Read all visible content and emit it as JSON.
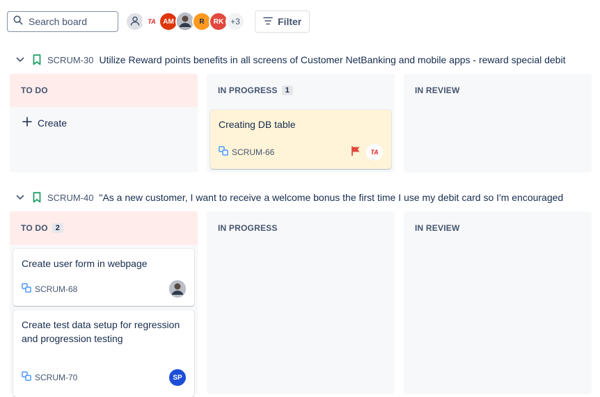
{
  "toolbar": {
    "search_placeholder": "Search board",
    "avatars": [
      {
        "kind": "default",
        "icon": "person-icon"
      },
      {
        "kind": "ta",
        "text": "TA"
      },
      {
        "kind": "am",
        "text": "AM"
      },
      {
        "kind": "photo",
        "icon": "user-photo-icon"
      },
      {
        "kind": "r",
        "text": "R"
      },
      {
        "kind": "rk",
        "text": "RK"
      }
    ],
    "more_count": "+3",
    "filter_label": "Filter"
  },
  "lanes": [
    {
      "key": "SCRUM-30",
      "title": "Utilize Reward points benefits in all screens of Customer NetBanking and mobile apps - reward special debit",
      "columns": [
        {
          "name": "TO DO",
          "count": "",
          "create_label": "Create"
        },
        {
          "name": "IN PROGRESS",
          "count": "1"
        },
        {
          "name": "IN REVIEW",
          "count": ""
        }
      ],
      "cards": [
        {
          "title": "Creating DB table",
          "key": "SCRUM-66",
          "assignee": "TA",
          "flagged": true
        }
      ]
    },
    {
      "key": "SCRUM-40",
      "title": "\"As a new customer, I want to receive a welcome bonus the first time I use my debit card so I'm encouraged",
      "columns": [
        {
          "name": "TO DO",
          "count": "2"
        },
        {
          "name": "IN PROGRESS",
          "count": ""
        },
        {
          "name": "IN REVIEW",
          "count": ""
        }
      ],
      "cards": [
        {
          "title": "Create user form in webpage",
          "key": "SCRUM-68",
          "assignee": "photo"
        },
        {
          "title": "Create test data setup for regression and progression testing",
          "key": "SCRUM-70",
          "assignee": "SP"
        }
      ]
    }
  ],
  "colors": {
    "todo_header": "#ffeceb",
    "column_bg": "#f7f8f9",
    "highlight_card": "#fff4d8",
    "subtask_icon": "#4c9aff",
    "flag": "#e2483d",
    "bookmark": "#22a06b",
    "sp_avatar": "#1d4ed8"
  }
}
